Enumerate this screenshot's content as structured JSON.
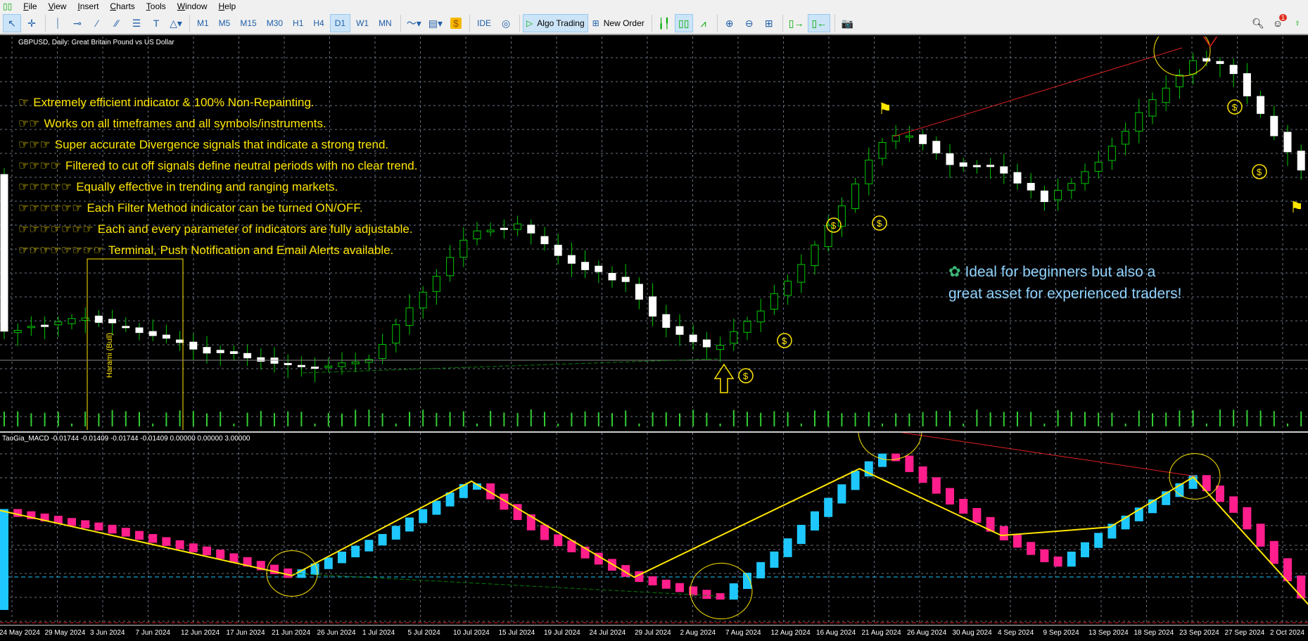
{
  "menu": [
    "File",
    "View",
    "Insert",
    "Charts",
    "Tools",
    "Window",
    "Help"
  ],
  "toolbar": {
    "timeframes": [
      "M1",
      "M5",
      "M15",
      "M30",
      "H1",
      "H4",
      "D1",
      "W1",
      "MN"
    ],
    "active_timeframe": "D1",
    "ide": "IDE",
    "algo_trading": "Algo Trading",
    "new_order": "New Order",
    "notification_count": "1"
  },
  "chart": {
    "title": "GBPUSD, Daily: Great Britain Pound vs US Dollar",
    "features": [
      {
        "hands": "☞",
        "text": "Extremely efficient indicator & 100% Non-Repainting."
      },
      {
        "hands": "☞☞",
        "text": "Works on all timeframes and all symbols/instruments."
      },
      {
        "hands": "☞☞☞",
        "text": "Super accurate Divergence signals that indicate a strong trend."
      },
      {
        "hands": "☞☞☞☞",
        "text": "Filtered to cut off signals define neutral periods with no clear trend."
      },
      {
        "hands": "☞☞☞☞☞",
        "text": "Equally effective in trending and ranging markets."
      },
      {
        "hands": "☞☞☞☞☞☞",
        "text": "Each Filter Method indicator can be turned ON/OFF."
      },
      {
        "hands": "☞☞☞☞☞☞☞",
        "text": "Each and every parameter of indicators are fully adjustable."
      },
      {
        "hands": "☞☞☞☞☞☞☞☞",
        "text": "Terminal, Push Notification and Email Alerts available."
      }
    ],
    "ideal_line1": "Ideal for beginners but also a",
    "ideal_line2": "great asset for experienced traders!",
    "pattern_label": "Harami (Bull)",
    "colors": {
      "bull": "#ffffff",
      "bear": "#ffffff",
      "wick": "#00c800",
      "volume": "#32cd32",
      "text": "#ffe600"
    }
  },
  "indicator": {
    "title": "TaoGia_MACD -0.01744 -0.01409 -0.01744 -0.01409 0.00000 0.00000 3.00000",
    "colors": {
      "up": "#1ec8ff",
      "down": "#ff1e8c",
      "zigzag": "#ffe600"
    }
  },
  "axis": {
    "dates": [
      "24 May 2024",
      "29 May 2024",
      "3 Jun 2024",
      "7 Jun 2024",
      "12 Jun 2024",
      "17 Jun 2024",
      "21 Jun 2024",
      "26 Jun 2024",
      "1 Jul 2024",
      "5 Jul 2024",
      "10 Jul 2024",
      "15 Jul 2024",
      "19 Jul 2024",
      "24 Jul 2024",
      "29 Jul 2024",
      "2 Aug 2024",
      "7 Aug 2024",
      "12 Aug 2024",
      "16 Aug 2024",
      "21 Aug 2024",
      "26 Aug 2024",
      "30 Aug 2024",
      "4 Sep 2024",
      "9 Sep 2024",
      "13 Sep 2024",
      "18 Sep 2024",
      "23 Sep 2024",
      "27 Sep 2024",
      "2 Oct 2024"
    ]
  }
}
